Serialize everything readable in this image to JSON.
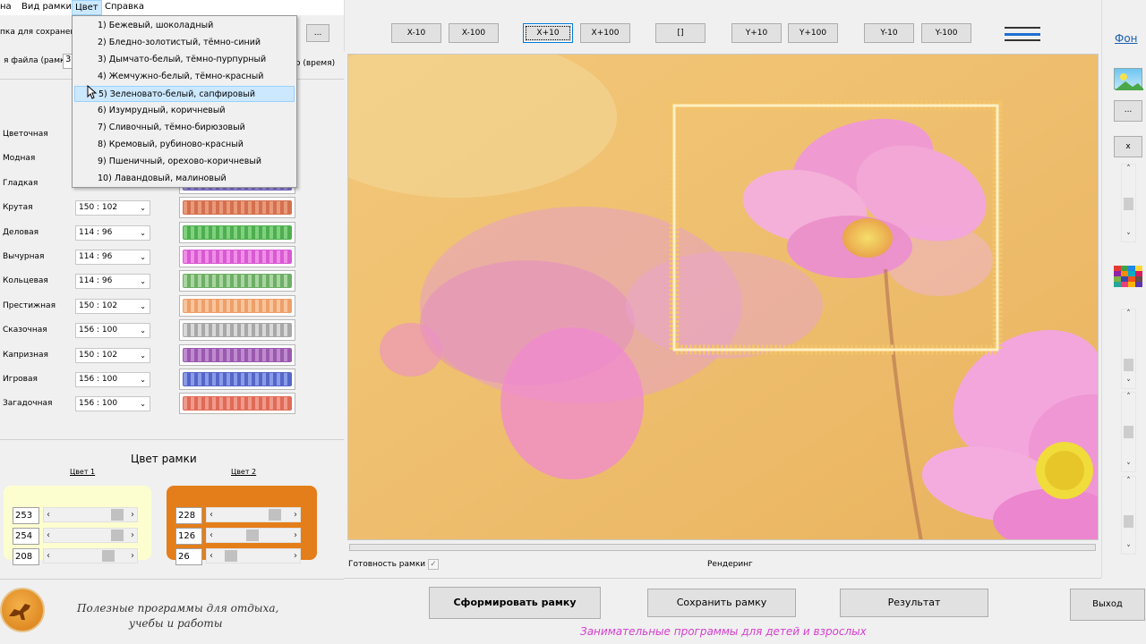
{
  "menubar": {
    "items": [
      "на",
      "Вид рамки",
      "Цвет",
      "Справка"
    ]
  },
  "left": {
    "save_folder_label": "пка для сохранен",
    "file_name_label": "я файла (рамка)",
    "file_name_value": "3",
    "time_label": "о (время)",
    "browse_label": "...",
    "styles": [
      {
        "name": "Цветочная",
        "size": "",
        "colors": [
          "#d8c8e8",
          "#b9a3d6"
        ]
      },
      {
        "name": "Модная",
        "size": "",
        "colors": [
          "#e7d3b8",
          "#c9a77f"
        ]
      },
      {
        "name": "Гладкая",
        "size": "",
        "colors": [
          "#a99be0",
          "#7f6fd0"
        ]
      },
      {
        "name": "Крутая",
        "size": "150 : 102",
        "colors": [
          "#e89a7a",
          "#d4704f"
        ]
      },
      {
        "name": "Деловая",
        "size": "114 : 96",
        "colors": [
          "#7fd17f",
          "#4fae4f"
        ]
      },
      {
        "name": "Вычурная",
        "size": "114 : 96",
        "colors": [
          "#f08ee8",
          "#d85ad2"
        ]
      },
      {
        "name": "Кольцевая",
        "size": "114 : 96",
        "colors": [
          "#a8d6a0",
          "#6fae66"
        ]
      },
      {
        "name": "Престижная",
        "size": "150 : 102",
        "colors": [
          "#f8c49b",
          "#eea06a"
        ]
      },
      {
        "name": "Сказочная",
        "size": "156 : 100",
        "colors": [
          "#d8d8d8",
          "#a8a8a8"
        ]
      },
      {
        "name": "Капризная",
        "size": "150 : 102",
        "colors": [
          "#c08ad0",
          "#9a5aae"
        ]
      },
      {
        "name": "Игровая",
        "size": "156 : 100",
        "colors": [
          "#8a9ce8",
          "#5566c8"
        ]
      },
      {
        "name": "Загадочная",
        "size": "156 : 100",
        "colors": [
          "#f09a8a",
          "#e06a58"
        ]
      }
    ],
    "color_title": "Цвет рамки",
    "color1_label": "Цвет 1",
    "color2_label": "Цвет 2",
    "color1": {
      "bg": "#fdfed0",
      "values": [
        "253",
        "254",
        "208"
      ],
      "levels": [
        0.99,
        0.99,
        0.82
      ]
    },
    "color2": {
      "bg": "#e47e1a",
      "values": [
        "228",
        "126",
        "26"
      ],
      "levels": [
        0.89,
        0.49,
        0.1
      ]
    },
    "slogan_line1": "Полезные программы для отдыха,",
    "slogan_line2": "учебы и работы"
  },
  "dropdown": {
    "items": [
      "1) Бежевый, шоколадный",
      "2) Бледно-золотистый, тёмно-синий",
      "3) Дымчато-белый, тёмно-пурпурный",
      "4) Жемчужно-белый, тёмно-красный",
      "5) Зеленовато-белый, сапфировый",
      "6) Изумрудный, коричневый",
      "7) Сливочный, тёмно-бирюзовый",
      "8) Кремовый, рубиново-красный",
      "9) Пшеничный, орехово-коричневый",
      "10) Лавандовый, малиновый"
    ],
    "selected_index": 4
  },
  "toolbar": {
    "buttons": [
      "X-10",
      "X-100",
      "X+10",
      "X+100",
      "[]",
      "Y+10",
      "Y+100",
      "Y-10",
      "Y-100"
    ],
    "focused": "X+10"
  },
  "status": {
    "ready_label": "Готовность рамки",
    "rendering_label": "Рендеринг"
  },
  "actions": {
    "build": "Сформировать рамку",
    "save": "Сохранить рамку",
    "result": "Результат",
    "exit": "Выход"
  },
  "footer_text": "Занимательные программы для детей и взрослых",
  "right": {
    "bg_label": "Фон",
    "more_label": "...",
    "close_label": "x"
  },
  "colors": {
    "accent_pink": "#d63fd1",
    "frame_gold": "#f3c46a",
    "selection_blue": "#cce8ff"
  }
}
